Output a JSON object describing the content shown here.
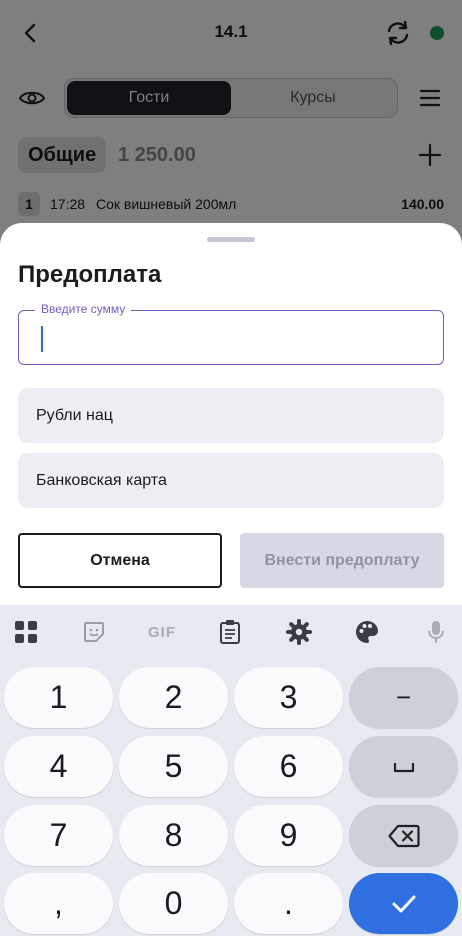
{
  "header": {
    "title": "14.1",
    "status_color": "#1f9d55"
  },
  "tabs": [
    {
      "label": "Гости",
      "active": true
    },
    {
      "label": "Курсы",
      "active": false
    }
  ],
  "section": {
    "name": "Общие",
    "total": "1 250.00"
  },
  "order": {
    "index": "1",
    "time": "17:28",
    "name": "Сок вишневый 200мл",
    "price": "140.00"
  },
  "sheet": {
    "title": "Предоплата",
    "amount_label": "Введите сумму",
    "amount_value": "",
    "payment_methods": [
      "Рубли нац",
      "Банковская карта"
    ],
    "cancel_label": "Отмена",
    "submit_label": "Внести предоплату"
  },
  "keyboard": {
    "toolbar_icons": [
      "apps-grid-icon",
      "sticker-icon",
      "gif-icon",
      "clipboard-icon",
      "settings-gear-icon",
      "palette-icon",
      "microphone-icon"
    ],
    "gif_label": "GIF",
    "rows": [
      [
        "1",
        "2",
        "3",
        "−"
      ],
      [
        "4",
        "5",
        "6",
        "␣"
      ],
      [
        "7",
        "8",
        "9",
        "backspace"
      ],
      [
        ",",
        "0",
        ".",
        "enter"
      ]
    ]
  },
  "colors": {
    "accent": "#2f6fe0",
    "field_focus": "#6d5fc4",
    "tab_active": "#1f2229"
  }
}
